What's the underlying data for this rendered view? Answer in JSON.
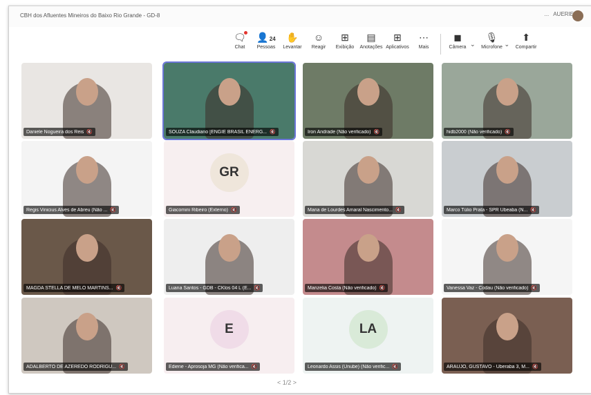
{
  "window": {
    "title": "CBH dos Afluentes Mineiros do Baixo Rio Grande - GD-8",
    "more": "...",
    "user_name": "AUERIE"
  },
  "toolbar": {
    "chat": "Chat",
    "people_count": "24",
    "people": "Pessoas",
    "raise": "Levantar",
    "react": "Reagir",
    "view": "Exibição",
    "notes": "Anotações",
    "apps": "Aplicativos",
    "more": "Mais",
    "camera": "Câmera",
    "mic": "Microfone",
    "share": "Compartir"
  },
  "participants": [
    {
      "name": "Daniele Nogueira dos Reis",
      "bg": "#e9e6e3"
    },
    {
      "name": "SOUZA Claudiano [ENGIE BRASIL ENERG...",
      "bg": "#4a7a6a"
    },
    {
      "name": "Iron Andrade (Não verificado)",
      "bg": "#6e7b66"
    },
    {
      "name": "hidb2000 (Não verificado)",
      "bg": "#9aa79a"
    },
    {
      "name": "Regis Vinicius Alves de Abreu (Não ...",
      "bg": "#f4f4f4"
    },
    {
      "name": "Giacomini Ribeiro (Externo)",
      "initials": "GR",
      "bg": "#f7eff0",
      "avatar": "#efe6db"
    },
    {
      "name": "Maria de Lourdes Amaral Nascimento...",
      "bg": "#d8d8d4"
    },
    {
      "name": "Marco Túlio Prata - SPR Ubeaba (N...",
      "bg": "#c9cdd0"
    },
    {
      "name": "MAGDA STELLA DE MELO MARTINS...",
      "bg": "#6a5849"
    },
    {
      "name": "Luana Santos - GDB - CKlos 04 L (E...",
      "bg": "#eeeeee"
    },
    {
      "name": "Marizelia Costa (Não verificado)",
      "bg": "#c48b8d"
    },
    {
      "name": "Vanessa Vaz - Codau (Não verificado)",
      "bg": "#f5f5f5"
    },
    {
      "name": "ADALBERTO DE AZEREDO RODRIGU...",
      "bg": "#cfc8c0"
    },
    {
      "name": "Ediene - Aprosoja MG (Não verifica...",
      "initials": "E",
      "bg": "#f7eef0",
      "avatar": "#f0dce8"
    },
    {
      "name": "Leonardo Assis (Unube) (Não verific...",
      "initials": "LA",
      "bg": "#eef3f2",
      "avatar": "#d9ead8"
    },
    {
      "name": "ARAUJO, GUSTAVO - Uberaba 3, M...",
      "bg": "#7a5f52"
    }
  ],
  "pager": "< 1/2 >"
}
